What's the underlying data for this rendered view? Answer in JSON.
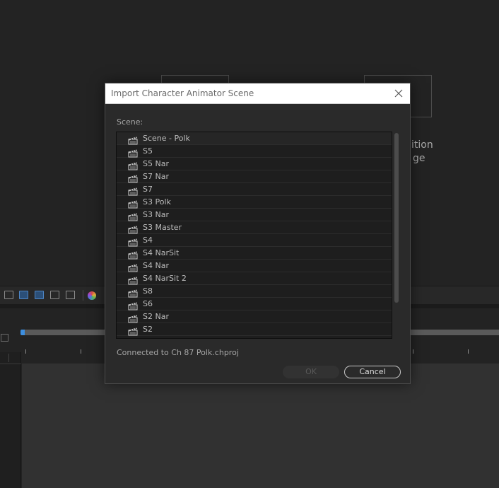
{
  "background": {
    "tile_text_line1": "ition",
    "tile_text_line2": "ge",
    "accent_color": "#3d8fe0"
  },
  "dialog": {
    "title": "Import Character Animator Scene",
    "close_icon": "close-icon",
    "scene_label": "Scene:",
    "scenes": [
      "Scene - Polk",
      "S5",
      "S5 Nar",
      "S7 Nar",
      "S7",
      "S3 Polk",
      "S3 Nar",
      "S3 Master",
      "S4",
      "S4 NarSit",
      "S4 Nar",
      "S4 NarSit 2",
      "S8",
      "S6",
      "S2 Nar",
      "S2"
    ],
    "scene_icon": "clapperboard-icon",
    "status": "Connected to Ch 87 Polk.chproj",
    "ok_label": "OK",
    "cancel_label": "Cancel"
  }
}
